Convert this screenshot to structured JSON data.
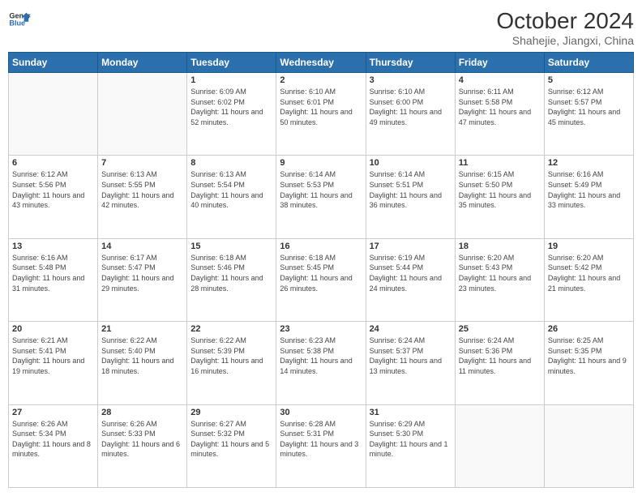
{
  "header": {
    "logo_line1": "General",
    "logo_line2": "Blue",
    "title": "October 2024",
    "subtitle": "Shahejie, Jiangxi, China"
  },
  "days": [
    "Sunday",
    "Monday",
    "Tuesday",
    "Wednesday",
    "Thursday",
    "Friday",
    "Saturday"
  ],
  "weeks": [
    [
      {
        "date": "",
        "empty": true
      },
      {
        "date": "",
        "empty": true
      },
      {
        "date": "1",
        "sunrise": "6:09 AM",
        "sunset": "6:02 PM",
        "daylight": "11 hours and 52 minutes."
      },
      {
        "date": "2",
        "sunrise": "6:10 AM",
        "sunset": "6:01 PM",
        "daylight": "11 hours and 50 minutes."
      },
      {
        "date": "3",
        "sunrise": "6:10 AM",
        "sunset": "6:00 PM",
        "daylight": "11 hours and 49 minutes."
      },
      {
        "date": "4",
        "sunrise": "6:11 AM",
        "sunset": "5:58 PM",
        "daylight": "11 hours and 47 minutes."
      },
      {
        "date": "5",
        "sunrise": "6:12 AM",
        "sunset": "5:57 PM",
        "daylight": "11 hours and 45 minutes."
      }
    ],
    [
      {
        "date": "6",
        "sunrise": "6:12 AM",
        "sunset": "5:56 PM",
        "daylight": "11 hours and 43 minutes."
      },
      {
        "date": "7",
        "sunrise": "6:13 AM",
        "sunset": "5:55 PM",
        "daylight": "11 hours and 42 minutes."
      },
      {
        "date": "8",
        "sunrise": "6:13 AM",
        "sunset": "5:54 PM",
        "daylight": "11 hours and 40 minutes."
      },
      {
        "date": "9",
        "sunrise": "6:14 AM",
        "sunset": "5:53 PM",
        "daylight": "11 hours and 38 minutes."
      },
      {
        "date": "10",
        "sunrise": "6:14 AM",
        "sunset": "5:51 PM",
        "daylight": "11 hours and 36 minutes."
      },
      {
        "date": "11",
        "sunrise": "6:15 AM",
        "sunset": "5:50 PM",
        "daylight": "11 hours and 35 minutes."
      },
      {
        "date": "12",
        "sunrise": "6:16 AM",
        "sunset": "5:49 PM",
        "daylight": "11 hours and 33 minutes."
      }
    ],
    [
      {
        "date": "13",
        "sunrise": "6:16 AM",
        "sunset": "5:48 PM",
        "daylight": "11 hours and 31 minutes."
      },
      {
        "date": "14",
        "sunrise": "6:17 AM",
        "sunset": "5:47 PM",
        "daylight": "11 hours and 29 minutes."
      },
      {
        "date": "15",
        "sunrise": "6:18 AM",
        "sunset": "5:46 PM",
        "daylight": "11 hours and 28 minutes."
      },
      {
        "date": "16",
        "sunrise": "6:18 AM",
        "sunset": "5:45 PM",
        "daylight": "11 hours and 26 minutes."
      },
      {
        "date": "17",
        "sunrise": "6:19 AM",
        "sunset": "5:44 PM",
        "daylight": "11 hours and 24 minutes."
      },
      {
        "date": "18",
        "sunrise": "6:20 AM",
        "sunset": "5:43 PM",
        "daylight": "11 hours and 23 minutes."
      },
      {
        "date": "19",
        "sunrise": "6:20 AM",
        "sunset": "5:42 PM",
        "daylight": "11 hours and 21 minutes."
      }
    ],
    [
      {
        "date": "20",
        "sunrise": "6:21 AM",
        "sunset": "5:41 PM",
        "daylight": "11 hours and 19 minutes."
      },
      {
        "date": "21",
        "sunrise": "6:22 AM",
        "sunset": "5:40 PM",
        "daylight": "11 hours and 18 minutes."
      },
      {
        "date": "22",
        "sunrise": "6:22 AM",
        "sunset": "5:39 PM",
        "daylight": "11 hours and 16 minutes."
      },
      {
        "date": "23",
        "sunrise": "6:23 AM",
        "sunset": "5:38 PM",
        "daylight": "11 hours and 14 minutes."
      },
      {
        "date": "24",
        "sunrise": "6:24 AM",
        "sunset": "5:37 PM",
        "daylight": "11 hours and 13 minutes."
      },
      {
        "date": "25",
        "sunrise": "6:24 AM",
        "sunset": "5:36 PM",
        "daylight": "11 hours and 11 minutes."
      },
      {
        "date": "26",
        "sunrise": "6:25 AM",
        "sunset": "5:35 PM",
        "daylight": "11 hours and 9 minutes."
      }
    ],
    [
      {
        "date": "27",
        "sunrise": "6:26 AM",
        "sunset": "5:34 PM",
        "daylight": "11 hours and 8 minutes."
      },
      {
        "date": "28",
        "sunrise": "6:26 AM",
        "sunset": "5:33 PM",
        "daylight": "11 hours and 6 minutes."
      },
      {
        "date": "29",
        "sunrise": "6:27 AM",
        "sunset": "5:32 PM",
        "daylight": "11 hours and 5 minutes."
      },
      {
        "date": "30",
        "sunrise": "6:28 AM",
        "sunset": "5:31 PM",
        "daylight": "11 hours and 3 minutes."
      },
      {
        "date": "31",
        "sunrise": "6:29 AM",
        "sunset": "5:30 PM",
        "daylight": "11 hours and 1 minute."
      },
      {
        "date": "",
        "empty": true
      },
      {
        "date": "",
        "empty": true
      }
    ]
  ]
}
